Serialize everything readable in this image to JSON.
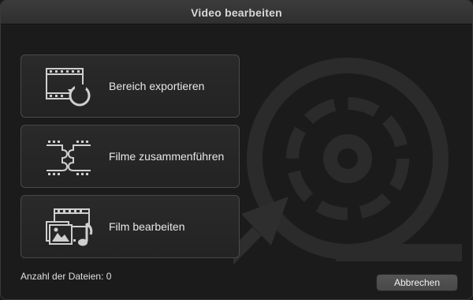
{
  "window": {
    "title": "Video bearbeiten"
  },
  "actions": [
    {
      "label": "Bereich exportieren",
      "icon": "film-rotate-icon"
    },
    {
      "label": "Filme zusammenführen",
      "icon": "film-puzzle-icon"
    },
    {
      "label": "Film bearbeiten",
      "icon": "film-photo-music-icon"
    }
  ],
  "footer": {
    "file_count_label": "Anzahl der Dateien: 0",
    "cancel_label": "Abbrechen"
  },
  "colors": {
    "background": "#1b1b1b",
    "button": "#2a2a2a",
    "icon": "#cfcfcf",
    "watermark": "#2b2b2b"
  }
}
